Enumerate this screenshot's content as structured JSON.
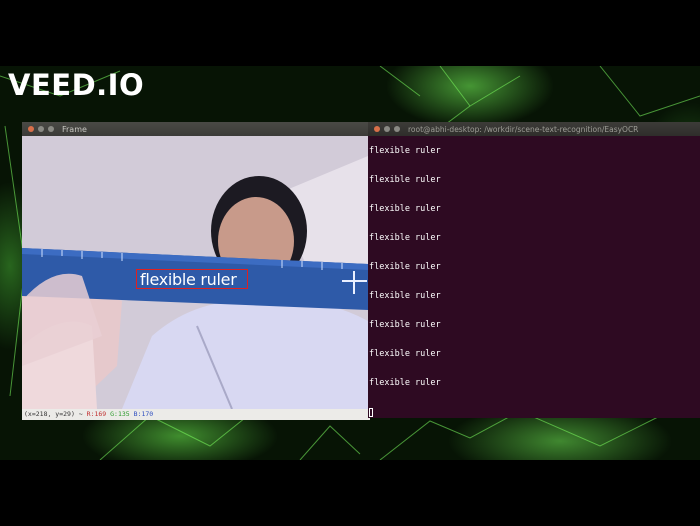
{
  "watermark": {
    "logo_text": "VEED.IO"
  },
  "frame_window": {
    "title": "Frame",
    "detection_text": "flexible ruler",
    "status": {
      "xy": "(x=218, y=29) ~",
      "r": "R:169",
      "g": "G:135",
      "b": "B:170"
    }
  },
  "terminal_window": {
    "title": "root@abhi-desktop: /workdir/scene-text-recognition/EasyOCR",
    "lines": [
      "flexible ruler",
      "flexible ruler",
      "flexible ruler",
      "flexible ruler",
      "flexible ruler",
      "flexible ruler",
      "flexible ruler",
      "flexible ruler",
      "flexible ruler"
    ]
  },
  "colors": {
    "terminal_bg": "#2e0a22",
    "detection_box": "#e02020",
    "wallpaper_glow": "#78ff5a"
  }
}
